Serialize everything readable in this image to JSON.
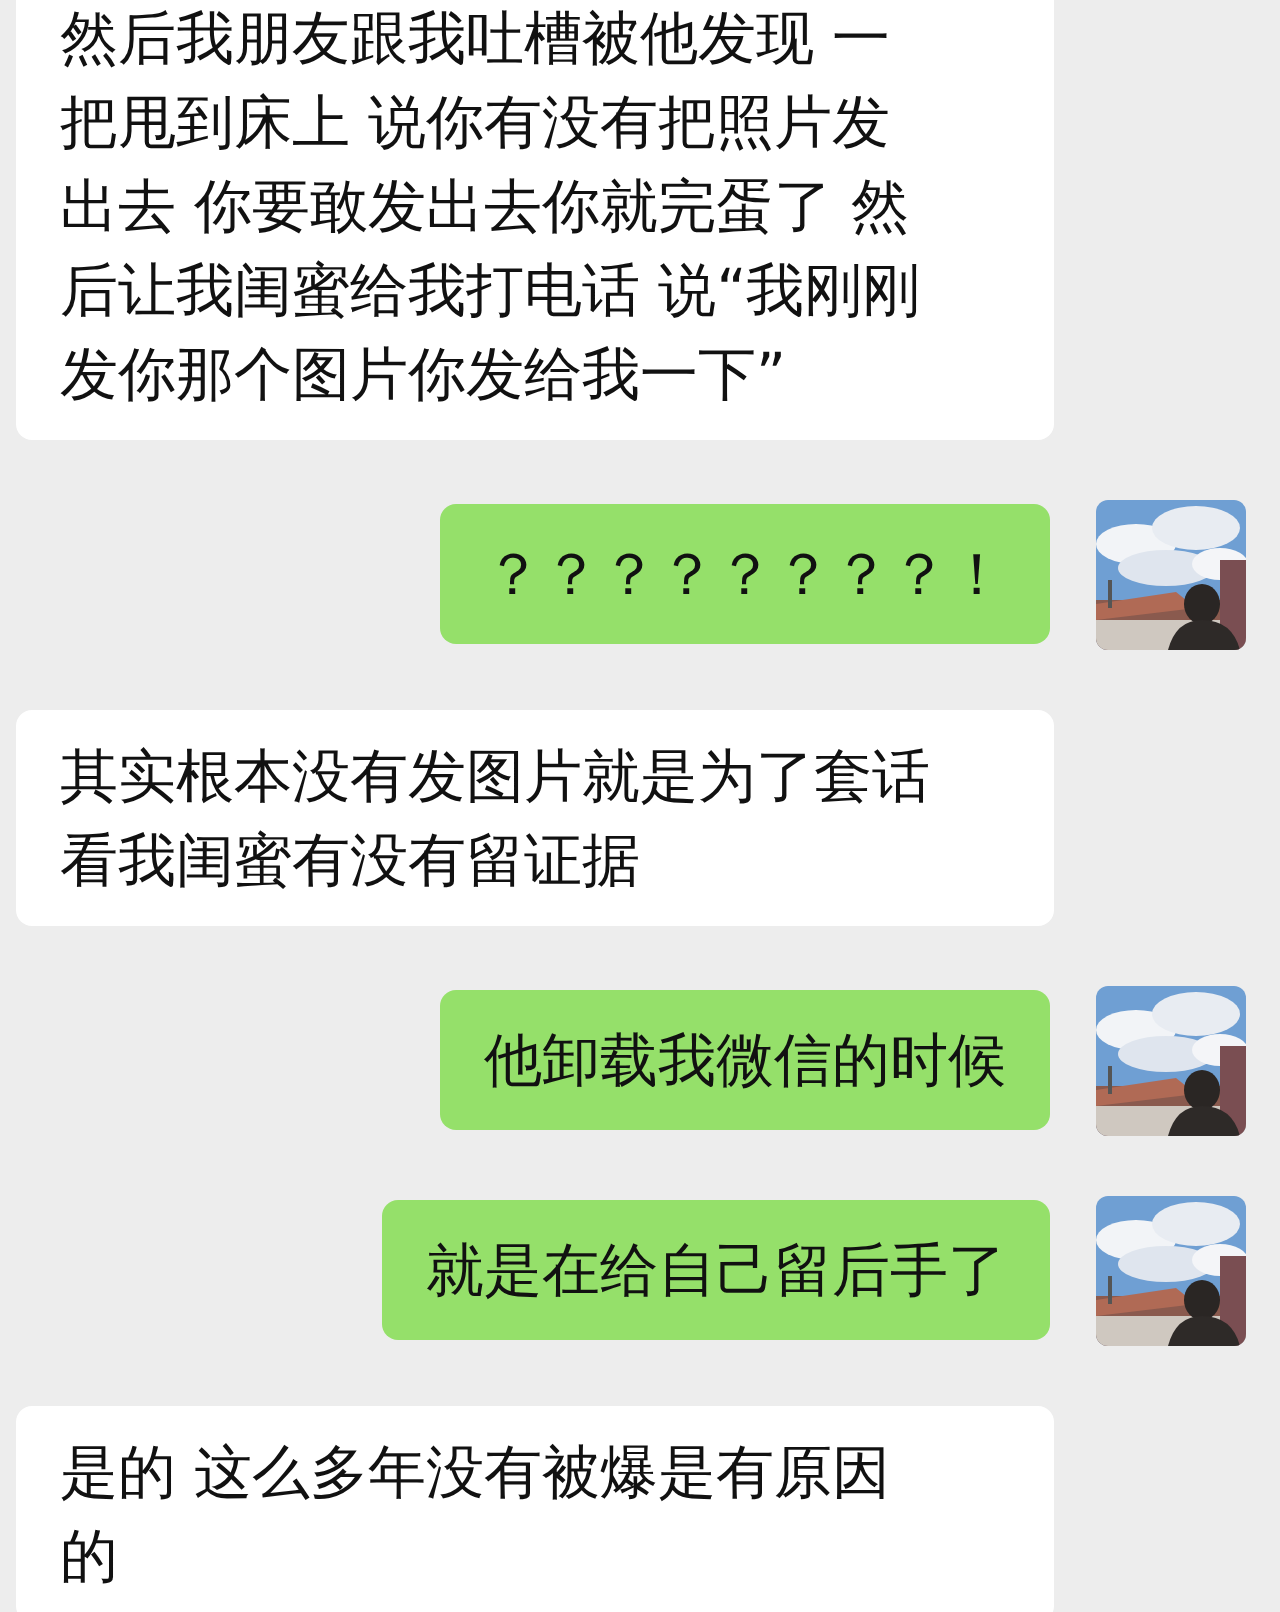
{
  "messages": [
    {
      "kind": "incoming",
      "text": "然后我朋友跟我吐槽被他发现 一把甩到床上 说你有没有把照片发出去 你要敢发出去你就完蛋了 然后让我闺蜜给我打电话 说“我刚刚发你那个图片你发给我一下”"
    },
    {
      "kind": "outgoing",
      "text": "？？？？？？？？！"
    },
    {
      "kind": "incoming",
      "text": "其实根本没有发图片就是为了套话看我闺蜜有没有留证据"
    },
    {
      "kind": "outgoing",
      "text": "他卸载我微信的时候"
    },
    {
      "kind": "outgoing",
      "text": "就是在给自己留后手了"
    },
    {
      "kind": "incoming",
      "text": "是的 这么多年没有被爆是有原因的"
    }
  ]
}
